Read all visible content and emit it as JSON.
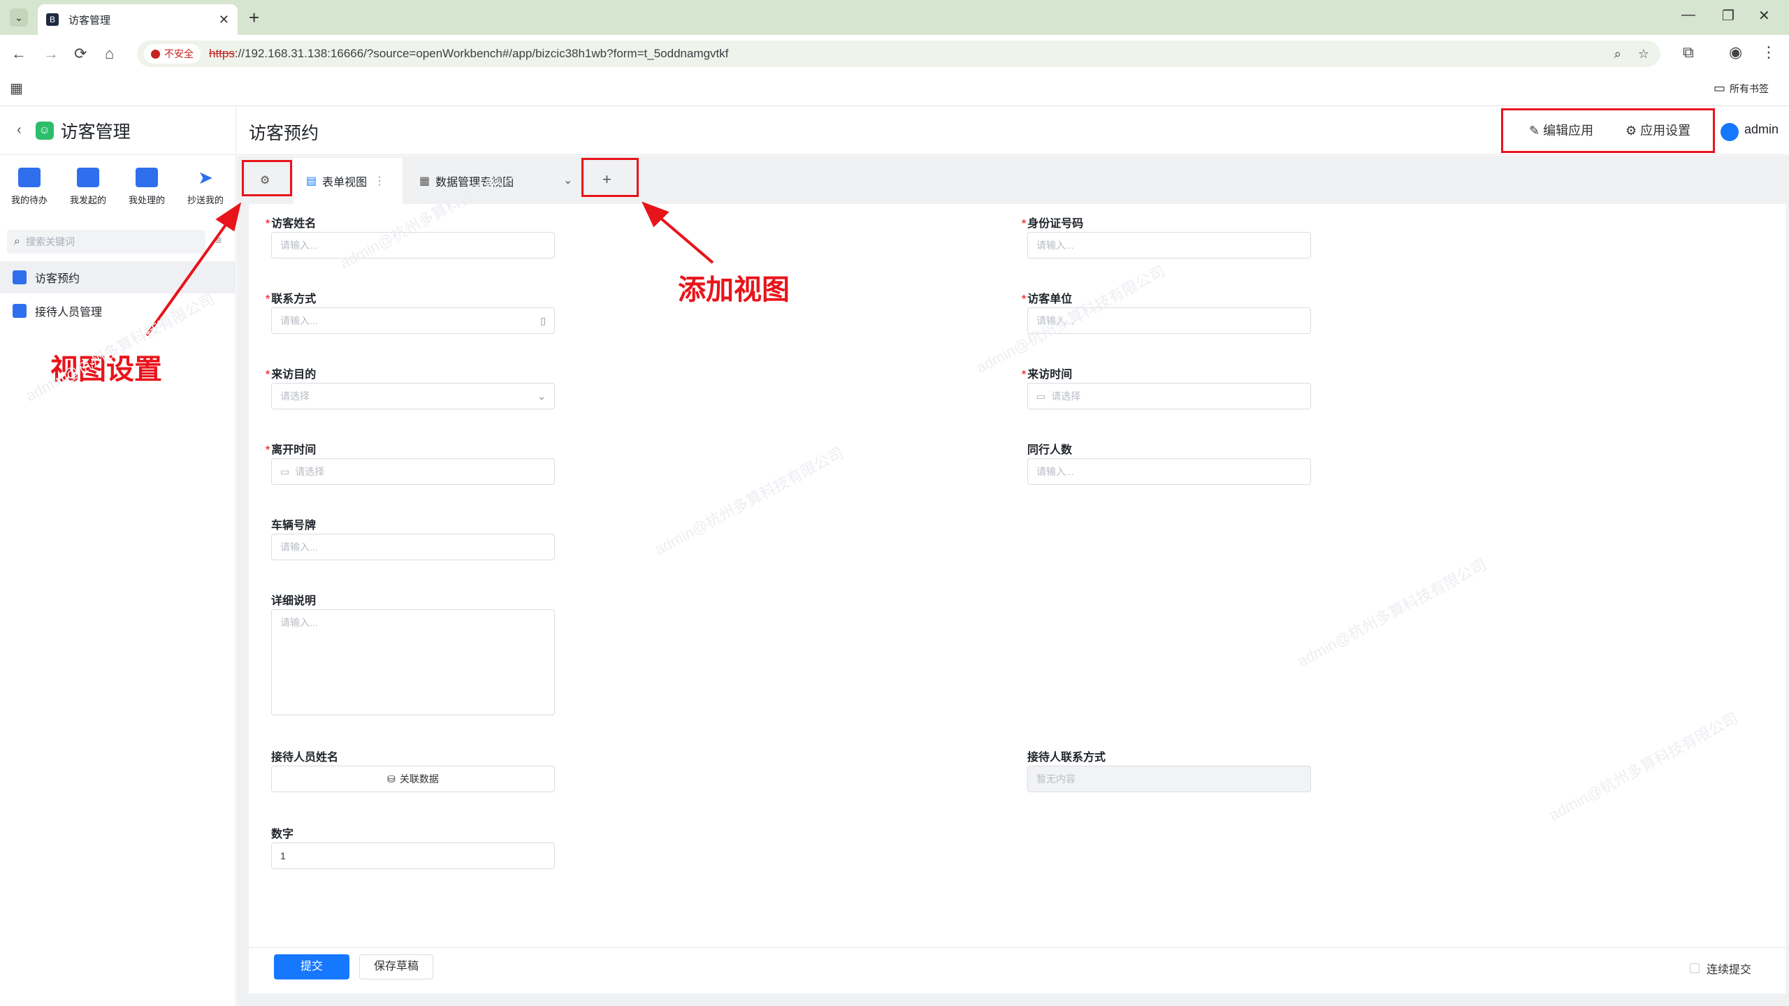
{
  "browser": {
    "tab_title": "访客管理",
    "tab_close": "✕",
    "new_tab": "+",
    "insecure_label": "不安全",
    "url_scheme": "https",
    "url_rest": "://192.168.31.138:16666/?source=openWorkbench#/app/bizcic38h1wb?form=t_5oddnamgvtkf",
    "bookmarks_label": "所有书签"
  },
  "app": {
    "name": "访客管理",
    "quick_actions": [
      "我的待办",
      "我发起的",
      "我处理的",
      "抄送我的"
    ],
    "search_placeholder": "搜索关键词",
    "nav": [
      "访客预约",
      "接待人员管理"
    ],
    "page_title": "访客预约",
    "edit_app": "编辑应用",
    "app_settings": "应用设置",
    "user": "admin"
  },
  "views": {
    "tabs": [
      "表单视图",
      "数据管理表视图"
    ],
    "add": "+"
  },
  "form": {
    "fields": {
      "visitor_name": {
        "label": "访客姓名",
        "placeholder": "请输入..."
      },
      "id_number": {
        "label": "身份证号码",
        "placeholder": "请输入..."
      },
      "contact": {
        "label": "联系方式",
        "placeholder": "请输入..."
      },
      "company": {
        "label": "访客单位",
        "placeholder": "请输入..."
      },
      "purpose": {
        "label": "来访目的",
        "placeholder": "请选择"
      },
      "visit_time": {
        "label": "来访时间",
        "placeholder": "请选择"
      },
      "leave_time": {
        "label": "离开时间",
        "placeholder": "请选择"
      },
      "companions": {
        "label": "同行人数",
        "placeholder": "请输入..."
      },
      "plate": {
        "label": "车辆号牌",
        "placeholder": "请输入..."
      },
      "details": {
        "label": "详细说明",
        "placeholder": "请输入..."
      },
      "receptionist": {
        "label": "接待人员姓名",
        "button": "关联数据"
      },
      "receptionist_contact": {
        "label": "接待人联系方式",
        "value": "暂无内容"
      },
      "number": {
        "label": "数字",
        "value": "1"
      }
    },
    "submit": "提交",
    "save_draft": "保存草稿",
    "continuous_submit": "连续提交"
  },
  "annotations": {
    "view_settings": "视图设置",
    "add_view": "添加视图"
  },
  "watermark": "admin@杭州多算科技有限公司"
}
